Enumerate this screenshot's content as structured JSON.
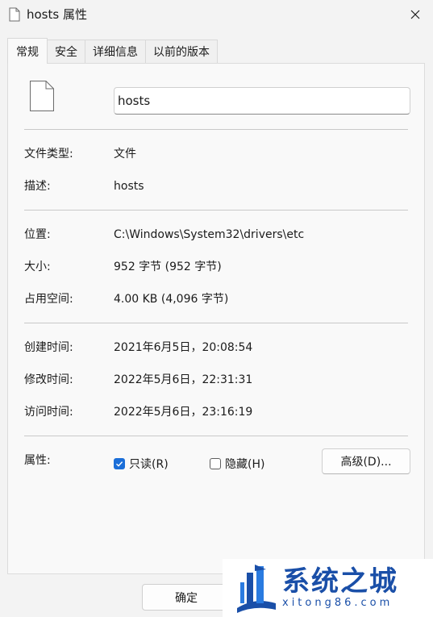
{
  "window": {
    "title": "hosts 属性"
  },
  "tabs": [
    {
      "label": "常规",
      "active": true
    },
    {
      "label": "安全",
      "active": false
    },
    {
      "label": "详细信息",
      "active": false
    },
    {
      "label": "以前的版本",
      "active": false
    }
  ],
  "general": {
    "file_name": "hosts",
    "rows": {
      "type": {
        "label": "文件类型:",
        "value": "文件"
      },
      "description": {
        "label": "描述:",
        "value": "hosts"
      },
      "location": {
        "label": "位置:",
        "value": "C:\\Windows\\System32\\drivers\\etc"
      },
      "size": {
        "label": "大小:",
        "value": "952 字节 (952 字节)"
      },
      "size_on_disk": {
        "label": "占用空间:",
        "value": "4.00 KB (4,096 字节)"
      },
      "created": {
        "label": "创建时间:",
        "value": "2021年6月5日，20:08:54"
      },
      "modified": {
        "label": "修改时间:",
        "value": "2022年5月6日，22:31:31"
      },
      "accessed": {
        "label": "访问时间:",
        "value": "2022年5月6日，23:16:19"
      }
    },
    "attributes": {
      "label": "属性:",
      "readonly": {
        "label": "只读(R)",
        "checked": true
      },
      "hidden": {
        "label": "隐藏(H)",
        "checked": false
      },
      "advanced_label": "高级(D)..."
    }
  },
  "footer": {
    "ok_label": "确定"
  },
  "watermark": {
    "text_cn": "系统之城",
    "text_en": "xitong86.com"
  },
  "colors": {
    "accent": "#1a6ed8",
    "watermark": "#1a4fa8"
  }
}
